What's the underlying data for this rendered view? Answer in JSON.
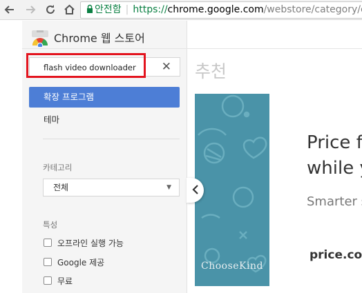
{
  "browser": {
    "secure_label": "안전함",
    "url_scheme": "https://",
    "url_host": "chrome.google.com",
    "url_path": "/webstore/category/ext"
  },
  "store": {
    "title": "Chrome 웹 스토어"
  },
  "search": {
    "value": "flash video downloader",
    "clear_symbol": "✕"
  },
  "sidebar": {
    "extensions_label": "확장 프로그램",
    "themes_label": "테마",
    "category_heading": "카테고리",
    "category_selected": "전체",
    "features_heading": "특성",
    "features": [
      {
        "label": "오프라인 실행 가능"
      },
      {
        "label": "Google 제공"
      },
      {
        "label": "무료"
      }
    ]
  },
  "main": {
    "heading": "추천",
    "banner_text": "ChooseKind",
    "promo_line1": "Price f",
    "promo_line2": "while y",
    "promo_sub": "Smarter s",
    "promo_site": "price.com"
  },
  "colors": {
    "accent": "#4d7ed6",
    "highlight": "#e3141e",
    "banner": "#4a93a8",
    "secure": "#0b8043"
  }
}
